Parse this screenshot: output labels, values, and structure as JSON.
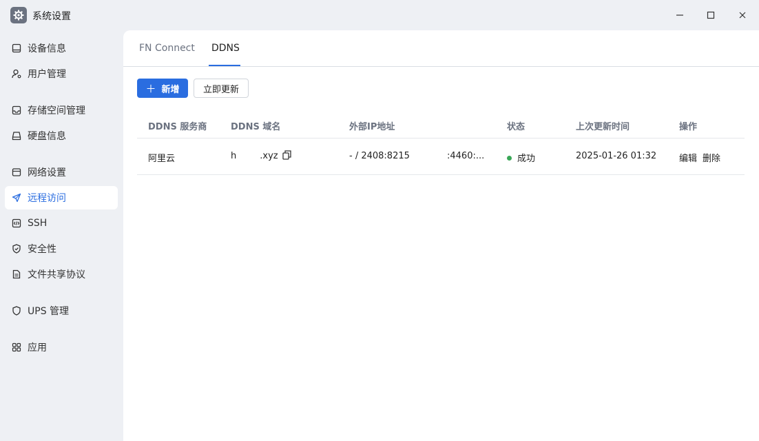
{
  "window": {
    "title": "系统设置",
    "icon": "gear-icon"
  },
  "sidebar": {
    "items": [
      {
        "label": "设备信息",
        "icon": "monitor-icon"
      },
      {
        "label": "用户管理",
        "icon": "user-icon"
      },
      {
        "label": "存储空间管理",
        "icon": "storage-icon"
      },
      {
        "label": "硬盘信息",
        "icon": "disk-icon"
      },
      {
        "label": "网络设置",
        "icon": "network-icon"
      },
      {
        "label": "远程访问",
        "icon": "send-icon",
        "active": true
      },
      {
        "label": "SSH",
        "icon": "code-icon"
      },
      {
        "label": "安全性",
        "icon": "shield-check-icon"
      },
      {
        "label": "文件共享协议",
        "icon": "file-icon"
      },
      {
        "label": "UPS 管理",
        "icon": "shield-icon"
      },
      {
        "label": "应用",
        "icon": "apps-icon"
      }
    ]
  },
  "tabs": [
    {
      "label": "FN Connect"
    },
    {
      "label": "DDNS",
      "active": true
    }
  ],
  "toolbar": {
    "add_label": "新增",
    "update_label": "立即更新"
  },
  "table": {
    "columns": [
      "DDNS 服务商",
      "DDNS 域名",
      "外部IP地址",
      "状态",
      "上次更新时间",
      "操作"
    ],
    "rows": [
      {
        "provider": "阿里云",
        "domain_prefix": "h",
        "domain_suffix": ".xyz",
        "ip_part1": "- / 2408:8215",
        "ip_part2": ":4460:...",
        "status": "成功",
        "updated": "2025-01-26 01:32",
        "action_edit": "编辑",
        "action_delete": "删除"
      }
    ]
  },
  "colors": {
    "accent": "#2a6de0",
    "status_ok": "#3aa757",
    "sidebar_bg": "#eef0f4"
  }
}
